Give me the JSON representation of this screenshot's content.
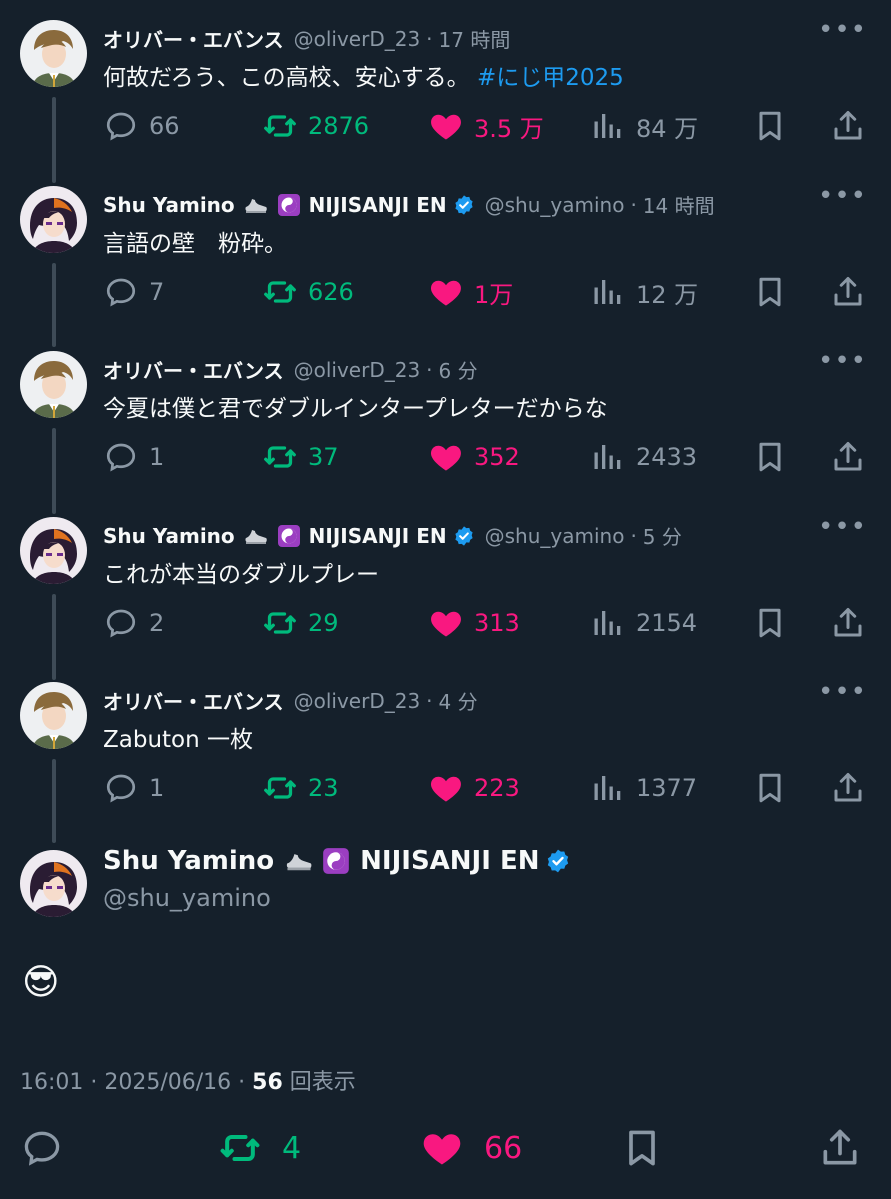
{
  "tweets": [
    {
      "name": "オリバー・エバンス",
      "handle": "@oliverD_23",
      "time": "17 時間",
      "text": "何故だろう、この高校、安心する。",
      "hashtag": "#にじ甲2025",
      "replies": "66",
      "retweets": "2876",
      "likes": "3.5 万",
      "views": "84 万"
    },
    {
      "name": "Shu Yamino",
      "org": "NIJISANJI EN",
      "handle": "@shu_yamino",
      "time": "14 時間",
      "text": "言語の壁　粉砕。",
      "replies": "7",
      "retweets": "626",
      "likes": "1万",
      "views": "12 万"
    },
    {
      "name": "オリバー・エバンス",
      "handle": "@oliverD_23",
      "time": "6 分",
      "text": "今夏は僕と君でダブルインタープレターだからな",
      "replies": "1",
      "retweets": "37",
      "likes": "352",
      "views": "2433"
    },
    {
      "name": "Shu Yamino",
      "org": "NIJISANJI EN",
      "handle": "@shu_yamino",
      "time": "5 分",
      "text": "これが本当のダブルプレー",
      "replies": "2",
      "retweets": "29",
      "likes": "313",
      "views": "2154"
    },
    {
      "name": "オリバー・エバンス",
      "handle": "@oliverD_23",
      "time": "4 分",
      "text": "Zabuton 一枚",
      "replies": "1",
      "retweets": "23",
      "likes": "223",
      "views": "1377"
    }
  ],
  "main": {
    "name": "Shu Yamino",
    "org": "NIJISANJI EN",
    "handle": "@shu_yamino",
    "body": "😎",
    "time": "16:01 · 2025/06/16 ·",
    "views_count": "56",
    "views_label": "回表示",
    "retweets": "4",
    "likes": "66"
  },
  "separator": "·",
  "more_label": "•••",
  "colors": {
    "background": "#15202b",
    "text": "#f7f9f9",
    "muted": "#8b98a5",
    "link": "#1d9bf0",
    "retweet": "#00ba7c",
    "like": "#f91880",
    "verified": "#1d9bf0"
  },
  "icons": [
    "reply-icon",
    "retweet-icon",
    "heart-icon",
    "views-icon",
    "bookmark-icon",
    "share-icon",
    "more-icon",
    "verified-icon",
    "sneaker-emoji",
    "yin-yang-emoji"
  ]
}
